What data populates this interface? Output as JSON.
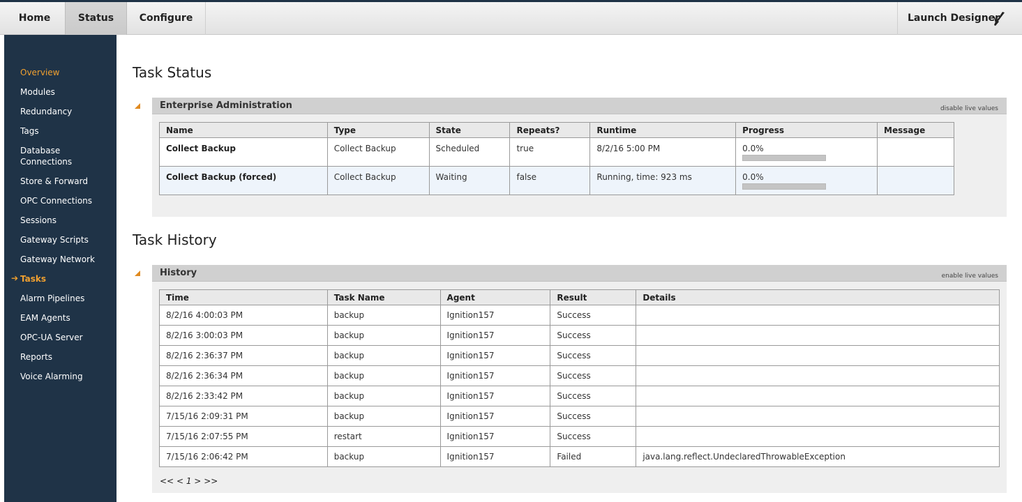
{
  "topnav": {
    "home": "Home",
    "status": "Status",
    "configure": "Configure",
    "launch": "Launch Designer"
  },
  "icons": {
    "launch": "pen-tool-icon",
    "collapse": "triangle-collapse-icon",
    "current_arrow": "arrow-right-icon"
  },
  "colors": {
    "sidebar_bg": "#1f3347",
    "accent": "#f0a030"
  },
  "sidebar": {
    "items": [
      {
        "label": "Overview",
        "state": "active"
      },
      {
        "label": "Modules"
      },
      {
        "label": "Redundancy"
      },
      {
        "label": "Tags"
      },
      {
        "label": "Database Connections"
      },
      {
        "label": "Store & Forward"
      },
      {
        "label": "OPC Connections"
      },
      {
        "label": "Sessions"
      },
      {
        "label": "Gateway Scripts"
      },
      {
        "label": "Gateway Network"
      },
      {
        "label": "Tasks",
        "state": "current"
      },
      {
        "label": "Alarm Pipelines"
      },
      {
        "label": "EAM Agents"
      },
      {
        "label": "OPC-UA Server"
      },
      {
        "label": "Reports"
      },
      {
        "label": "Voice Alarming"
      }
    ],
    "db_line1": "Database",
    "db_line2": "Connections",
    "current_arrow": "➔"
  },
  "task_status": {
    "title": "Task Status",
    "panel_title": "Enterprise Administration",
    "live_link": "disable live values",
    "columns": [
      "Name",
      "Type",
      "State",
      "Repeats?",
      "Runtime",
      "Progress",
      "Message"
    ],
    "rows": [
      {
        "name": "Collect Backup",
        "type": "Collect Backup",
        "state": "Scheduled",
        "repeats": "true",
        "runtime": "8/2/16 5:00 PM",
        "progress": "0.0%",
        "progress_value": 0,
        "message": ""
      },
      {
        "name": "Collect Backup (forced)",
        "type": "Collect Backup",
        "state": "Waiting",
        "repeats": "false",
        "runtime": "Running, time: 923 ms",
        "progress": "0.0%",
        "progress_value": 0,
        "message": ""
      }
    ]
  },
  "task_history": {
    "title": "Task History",
    "panel_title": "History",
    "live_link": "enable live values",
    "columns": [
      "Time",
      "Task Name",
      "Agent",
      "Result",
      "Details"
    ],
    "rows": [
      {
        "time": "8/2/16 4:00:03 PM",
        "task": "backup",
        "agent": "Ignition157",
        "result": "Success",
        "details": ""
      },
      {
        "time": "8/2/16 3:00:03 PM",
        "task": "backup",
        "agent": "Ignition157",
        "result": "Success",
        "details": ""
      },
      {
        "time": "8/2/16 2:36:37 PM",
        "task": "backup",
        "agent": "Ignition157",
        "result": "Success",
        "details": ""
      },
      {
        "time": "8/2/16 2:36:34 PM",
        "task": "backup",
        "agent": "Ignition157",
        "result": "Success",
        "details": ""
      },
      {
        "time": "8/2/16 2:33:42 PM",
        "task": "backup",
        "agent": "Ignition157",
        "result": "Success",
        "details": ""
      },
      {
        "time": "7/15/16 2:09:31 PM",
        "task": "backup",
        "agent": "Ignition157",
        "result": "Success",
        "details": ""
      },
      {
        "time": "7/15/16 2:07:55 PM",
        "task": "restart",
        "agent": "Ignition157",
        "result": "Success",
        "details": ""
      },
      {
        "time": "7/15/16 2:06:42 PM",
        "task": "backup",
        "agent": "Ignition157",
        "result": "Failed",
        "details": "java.lang.reflect.UndeclaredThrowableException"
      }
    ],
    "pager": {
      "first": "<<",
      "prev": "<",
      "page": "1",
      "next": ">",
      "last": ">>"
    }
  }
}
